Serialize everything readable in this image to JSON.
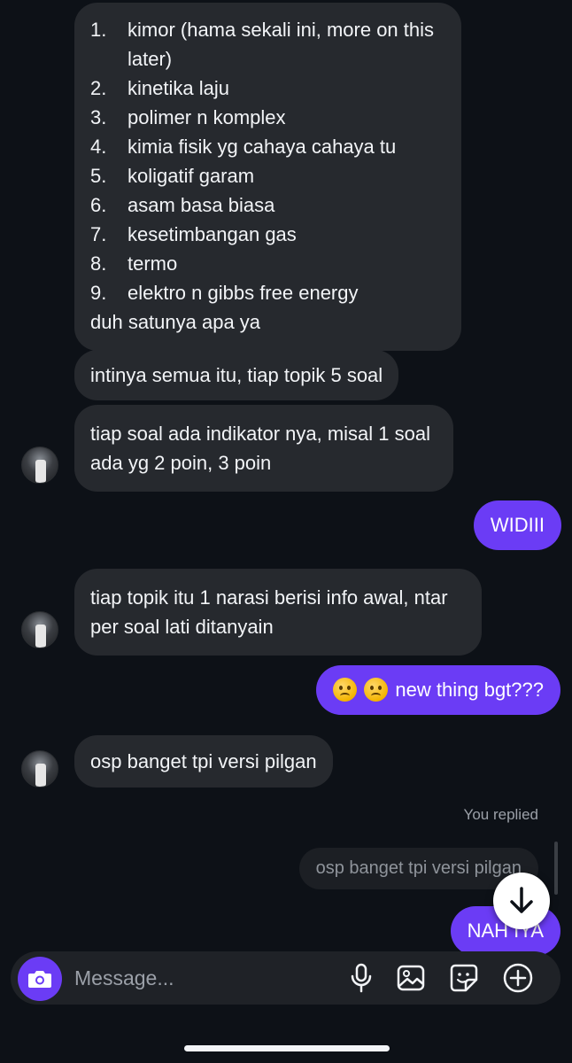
{
  "messages": {
    "m1": {
      "items": [
        {
          "num": "1.",
          "text": "kimor (hama sekali ini, more on this later)"
        },
        {
          "num": "2.",
          "text": "kinetika laju"
        },
        {
          "num": "3.",
          "text": "polimer n komplex"
        },
        {
          "num": "4.",
          "text": "kimia fisik yg cahaya cahaya tu"
        },
        {
          "num": "5.",
          "text": "koligatif garam"
        },
        {
          "num": "6.",
          "text": "asam basa biasa"
        },
        {
          "num": "7.",
          "text": "kesetimbangan gas"
        },
        {
          "num": "8.",
          "text": "termo"
        },
        {
          "num": "9.",
          "text": "elektro n gibbs free energy"
        }
      ],
      "footer": "duh satunya apa ya"
    },
    "m2": "intinya semua itu, tiap topik 5 soal",
    "m3": "tiap soal ada indikator nya, misal 1 soal ada yg 2 poin, 3 poin",
    "m4": "WIDIII",
    "m5": "tiap topik itu 1 narasi berisi info awal, ntar per soal lati ditanyain",
    "m6": {
      "emojis": "😟😟",
      "text": "new thing bgt???"
    },
    "m7": "osp banget tpi versi pilgan",
    "reply": {
      "label": "You replied",
      "quote": "osp banget tpi versi pilgan"
    },
    "m8": "NAH IYA"
  },
  "composer": {
    "placeholder": "Message..."
  },
  "icons": {
    "camera": "camera-icon",
    "mic": "microphone-icon",
    "gallery": "image-icon",
    "sticker": "sticker-icon",
    "add": "plus-circle-icon",
    "scroll": "arrow-down-icon"
  },
  "colors": {
    "background": "#0d1117",
    "incoming_bubble": "#26292e",
    "outgoing_bubble": "#6b3cf5",
    "accent": "#6b3cf5"
  }
}
